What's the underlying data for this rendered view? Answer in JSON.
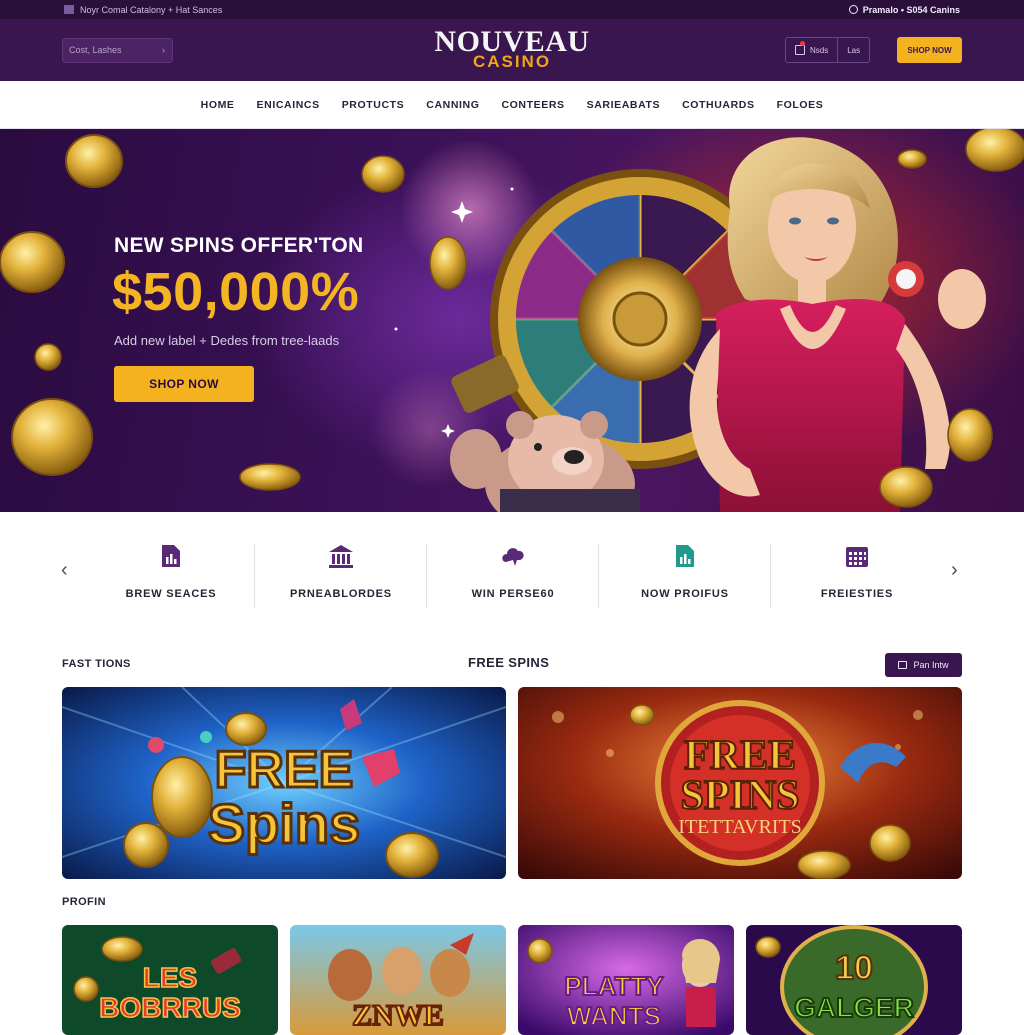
{
  "topbar": {
    "left_text": "Noyr Comal Catalony  +  Hat Sances",
    "right_text": "Pramalo  •  S054 Canins"
  },
  "header": {
    "search_placeholder": "Cost, Lashes",
    "logo_main": "NOUVEAU",
    "logo_sub": "CASINO",
    "account_label": "Nsds",
    "cart_label": "Las",
    "shop_button": "SHOP NOW"
  },
  "nav": {
    "items": [
      "HOME",
      "ENICAINCS",
      "PROTUCTS",
      "CANNING",
      "CONTEERS",
      "SARIEABATS",
      "COTHUARDS",
      "FOLOES"
    ]
  },
  "hero": {
    "title": "NEW SPINS OFFER'TON",
    "amount": "$50,000%",
    "subtitle": "Add new label + Dedes from tree-laads",
    "button": "SHOP NOW"
  },
  "categories": {
    "items": [
      {
        "label": "BREW SEACES",
        "icon": "document-chart-icon"
      },
      {
        "label": "PRNEABLORDES",
        "icon": "bank-icon"
      },
      {
        "label": "WIN PERSE60",
        "icon": "cloud-icon"
      },
      {
        "label": "NOW PROIFUS",
        "icon": "file-chart-icon"
      },
      {
        "label": "FREIESTIES",
        "icon": "calendar-grid-icon"
      }
    ]
  },
  "section": {
    "left_label": "FAST TIONS",
    "center_label": "FREE SPINS",
    "button_label": "Pan Intw"
  },
  "banners": [
    {
      "line1": "FREE",
      "line2": "Spins"
    },
    {
      "line1": "FREE",
      "line2": "SPINS",
      "line3": "ITETTAVRITS"
    }
  ],
  "profin_label": "PROFIN",
  "tiles": [
    {
      "line1": "LES",
      "line2": "BOBRRUS"
    },
    {
      "line1": "ZNWE"
    },
    {
      "line1": "PLATTY",
      "line2": "WANTS"
    },
    {
      "line1": "10",
      "line2": "GALGER"
    }
  ],
  "colors": {
    "brand_purple": "#3a1650",
    "accent_gold": "#f5b21f",
    "dark_text": "#2b2237"
  }
}
